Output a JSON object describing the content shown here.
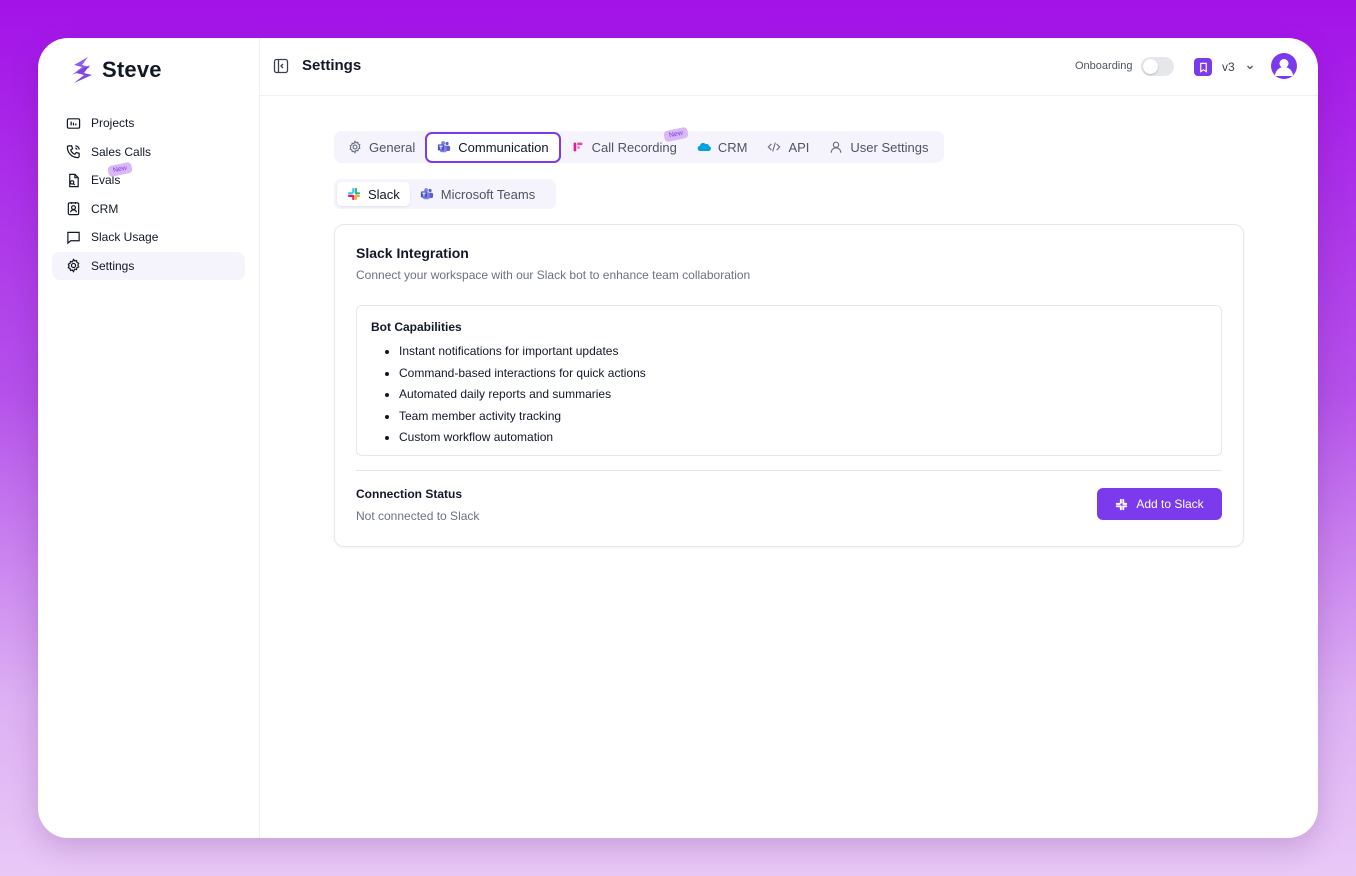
{
  "brand": {
    "name": "Steve"
  },
  "sidebar": {
    "items": [
      {
        "label": "Projects",
        "icon": "folder-icon"
      },
      {
        "label": "Sales Calls",
        "icon": "phone-icon"
      },
      {
        "label": "Evals",
        "icon": "file-search-icon",
        "badge": "New"
      },
      {
        "label": "CRM",
        "icon": "contact-icon"
      },
      {
        "label": "Slack Usage",
        "icon": "message-icon"
      },
      {
        "label": "Settings",
        "icon": "gear-icon",
        "active": true
      }
    ]
  },
  "header": {
    "title": "Settings",
    "onboarding_label": "Onboarding",
    "onboarding_enabled": false,
    "version_label": "v3"
  },
  "tabs": [
    {
      "label": "General",
      "icon": "gear-icon"
    },
    {
      "label": "Communication",
      "icon": "teams-icon",
      "active": true
    },
    {
      "label": "Call Recording",
      "icon": "recording-icon",
      "badge": "New"
    },
    {
      "label": "CRM",
      "icon": "salesforce-cloud-icon"
    },
    {
      "label": "API",
      "icon": "code-icon"
    },
    {
      "label": "User Settings",
      "icon": "user-icon"
    }
  ],
  "subtabs": [
    {
      "label": "Slack",
      "icon": "slack-icon",
      "active": true
    },
    {
      "label": "Microsoft Teams",
      "icon": "teams-icon"
    }
  ],
  "card": {
    "title": "Slack Integration",
    "subtitle": "Connect your workspace with our Slack bot to enhance team collaboration",
    "capabilities_title": "Bot Capabilities",
    "capabilities": [
      "Instant notifications for important updates",
      "Command-based interactions for quick actions",
      "Automated daily reports and summaries",
      "Team member activity tracking",
      "Custom workflow automation"
    ],
    "status_label": "Connection Status",
    "status_value": "Not connected to Slack",
    "add_button_label": "Add to Slack"
  },
  "colors": {
    "accent": "#7c3aed",
    "tab_bg": "#f5f3fc",
    "badge_bg": "#d9b8f5",
    "salesforce": "#00a1e0"
  }
}
